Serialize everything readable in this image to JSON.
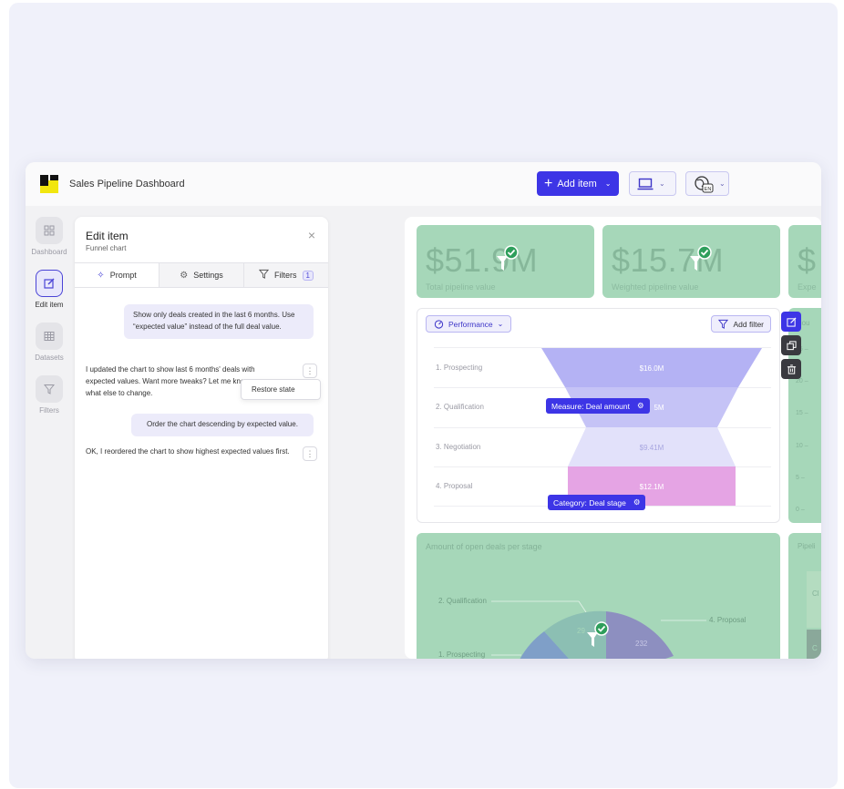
{
  "app": {
    "title": "Sales Pipeline Dashboard"
  },
  "toolbar": {
    "add_item_label": "Add item",
    "language_code": "EN"
  },
  "nav": {
    "items": [
      {
        "label": "Dashboard",
        "icon": "dashboard-icon"
      },
      {
        "label": "Edit item",
        "icon": "edit-icon"
      },
      {
        "label": "Datasets",
        "icon": "table-icon"
      },
      {
        "label": "Filters",
        "icon": "filter-icon"
      }
    ]
  },
  "panel": {
    "title": "Edit item",
    "subtitle": "Funnel chart",
    "tabs": [
      {
        "label": "Prompt",
        "icon": "sparkle-icon"
      },
      {
        "label": "Settings",
        "icon": "gear-icon"
      },
      {
        "label": "Filters",
        "icon": "filter-icon",
        "badge": "1"
      }
    ],
    "messages": [
      {
        "role": "user",
        "text": "Show only deals created in the last 6 months. Use “expected value” instead of the full deal value."
      },
      {
        "role": "bot",
        "text": "I updated the chart to show last 6 months' deals with expected values. Want more tweaks? Let me know what else to change."
      },
      {
        "role": "user",
        "text": "Order the chart descending by expected value."
      },
      {
        "role": "bot",
        "text": "OK, I reordered the chart to show highest expected values first."
      }
    ],
    "context_menu_item": "Restore state"
  },
  "kpis": [
    {
      "value": "$51.9M",
      "label": "Total pipeline value"
    },
    {
      "value": "$15.7M",
      "label": "Weighted pipeline value"
    },
    {
      "value": "$",
      "label": "Expe"
    }
  ],
  "funnel": {
    "performance_label": "Performance",
    "add_filter_label": "Add filter",
    "measure_tag": "Measure: Deal amount",
    "category_tag": "Category: Deal stage",
    "stages": [
      {
        "label": "1. Prospecting",
        "value": "$16.0M"
      },
      {
        "label": "2. Qualification",
        "value": "5M"
      },
      {
        "label": "3. Negotiation",
        "value": "$9.41M"
      },
      {
        "label": "4. Proposal",
        "value": "$12.1M"
      }
    ]
  },
  "right_chart": {
    "title": "mou",
    "ticks": [
      "25 –",
      "20 –",
      "15 –",
      "10 –",
      "5 –",
      "0 –"
    ]
  },
  "pie": {
    "title": "Amount of open deals per stage",
    "labels": [
      "2. Qualification",
      "4. Proposal",
      "1. Prospecting"
    ],
    "values": [
      "29",
      "232"
    ]
  },
  "pipeline_card": {
    "title": "Pipeli",
    "cells": [
      "Cl",
      "C"
    ]
  },
  "colors": {
    "accent": "#3d35e6",
    "kpi_green": "#a6d7b9",
    "funnel_blue": "#b4b2f4",
    "funnel_pink": "#e5a4e4",
    "success": "#2e9e5b"
  }
}
